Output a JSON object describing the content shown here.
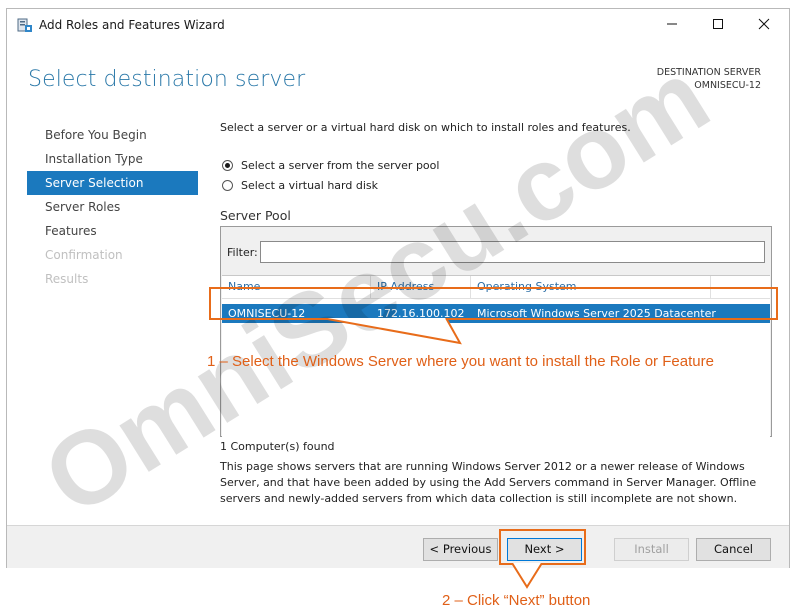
{
  "window": {
    "title": "Add Roles and Features Wizard"
  },
  "header": {
    "title": "Select destination server",
    "destination_label": "DESTINATION SERVER",
    "destination_value": "OMNISECU-12"
  },
  "nav": {
    "items": [
      {
        "label": "Before You Begin",
        "state": "normal"
      },
      {
        "label": "Installation Type",
        "state": "normal"
      },
      {
        "label": "Server Selection",
        "state": "active"
      },
      {
        "label": "Server Roles",
        "state": "normal"
      },
      {
        "label": "Features",
        "state": "normal"
      },
      {
        "label": "Confirmation",
        "state": "disabled"
      },
      {
        "label": "Results",
        "state": "disabled"
      }
    ]
  },
  "content": {
    "intro": "Select a server or a virtual hard disk on which to install roles and features.",
    "radio_options": [
      {
        "label": "Select a server from the server pool",
        "checked": true
      },
      {
        "label": "Select a virtual hard disk",
        "checked": false
      }
    ],
    "pool_title": "Server Pool",
    "filter_label": "Filter:",
    "filter_value": "",
    "columns": [
      "Name",
      "IP Address",
      "Operating System"
    ],
    "rows": [
      {
        "name": "OMNISECU-12",
        "ip": "172.16.100.102",
        "os": "Microsoft Windows Server 2025 Datacenter",
        "selected": true
      }
    ],
    "found_text": "1 Computer(s) found",
    "description": "This page shows servers that are running Windows Server 2012 or a newer release of Windows Server, and that have been added by using the Add Servers command in Server Manager. Offline servers and newly-added servers from which data collection is still incomplete are not shown."
  },
  "footer": {
    "previous": "< Previous",
    "next": "Next >",
    "install": "Install",
    "cancel": "Cancel"
  },
  "annotations": {
    "step1": "1 – Select the Windows Server where you want to install the Role or Feature",
    "step2": "2 – Click “Next” button",
    "watermark": "OmniSecu.com",
    "color": "#e86c1a"
  },
  "colors": {
    "accent": "#1b79be",
    "title_blue": "#2a78a8"
  },
  "icons": {
    "app": "server-manager-icon",
    "minimize": "minimize-icon",
    "maximize": "maximize-icon",
    "close": "close-icon"
  }
}
